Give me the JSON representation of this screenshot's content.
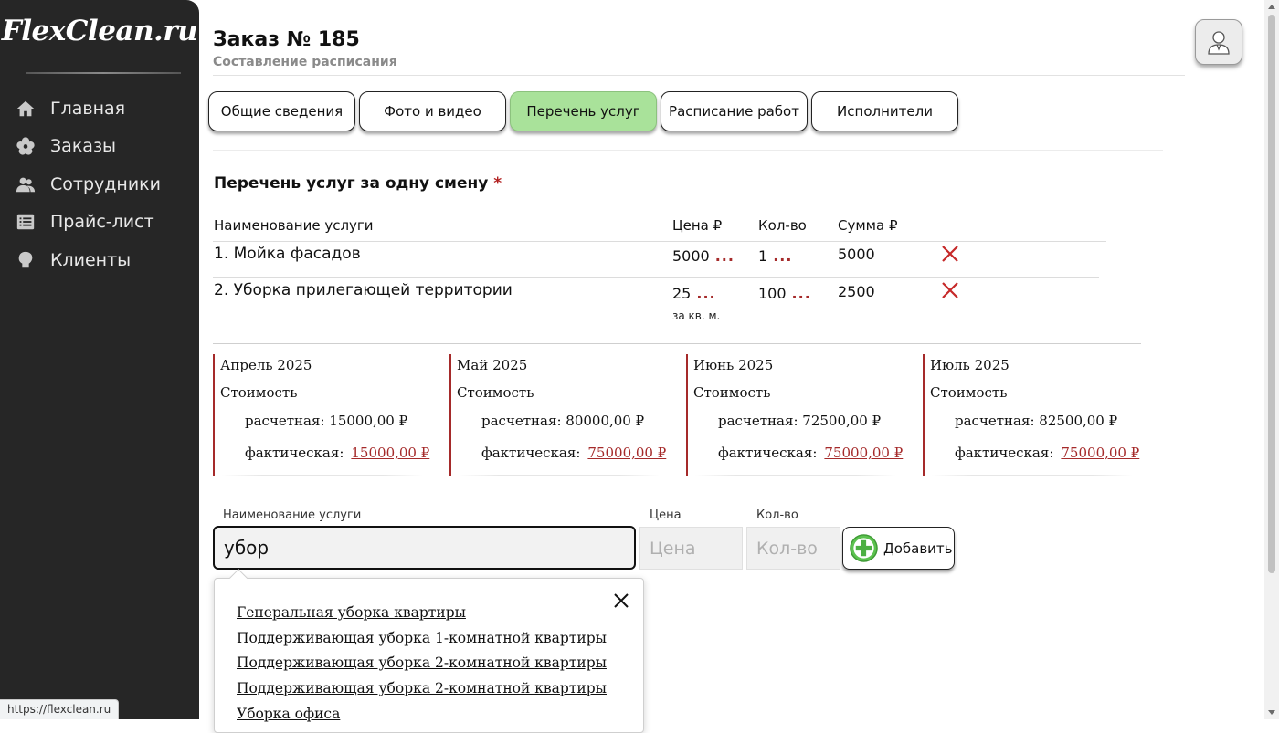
{
  "app": {
    "logo": "FlexClean.ru",
    "status_url": "https://flexclean.ru"
  },
  "sidebar": {
    "items": [
      {
        "label": "Главная",
        "icon": "home-icon"
      },
      {
        "label": "Заказы",
        "icon": "flower-icon"
      },
      {
        "label": "Сотрудники",
        "icon": "users-icon"
      },
      {
        "label": "Прайс-лист",
        "icon": "list-icon"
      },
      {
        "label": "Клиенты",
        "icon": "client-icon"
      }
    ]
  },
  "header": {
    "title": "Заказ № 185",
    "subtitle": "Составление расписания",
    "avatar_icon": "user-avatar-icon"
  },
  "tabs": [
    {
      "label": "Общие сведения",
      "active": false
    },
    {
      "label": "Фото и видео",
      "active": false
    },
    {
      "label": "Перечень услуг",
      "active": true
    },
    {
      "label": "Расписание работ",
      "active": false
    },
    {
      "label": "Исполнители",
      "active": false
    }
  ],
  "services": {
    "title": "Перечень услуг за одну смену",
    "required_mark": "*",
    "columns": {
      "name": "Наименование услуги",
      "price": "Цена ₽",
      "qty": "Кол-во",
      "sum": "Сумма ₽"
    },
    "more": "...",
    "rows": [
      {
        "name": "1. Мойка фасадов",
        "price": "5000",
        "qty": "1",
        "sum": "5000",
        "note": ""
      },
      {
        "name": "2. Уборка прилегающей территории",
        "price": "25",
        "qty": "100",
        "sum": "2500",
        "note": "за кв. м."
      }
    ]
  },
  "months": [
    {
      "name": "Апрель 2025",
      "cost_label": "Стоимость",
      "calc_label": "расчетная:",
      "calc": "15000,00 ₽",
      "fact_label": "фактическая:",
      "fact": "15000,00 ₽"
    },
    {
      "name": "Май 2025",
      "cost_label": "Стоимость",
      "calc_label": "расчетная:",
      "calc": "80000,00 ₽",
      "fact_label": "фактическая:",
      "fact": "75000,00 ₽"
    },
    {
      "name": "Июнь 2025",
      "cost_label": "Стоимость",
      "calc_label": "расчетная:",
      "calc": "72500,00 ₽",
      "fact_label": "фактическая:",
      "fact": "75000,00 ₽"
    },
    {
      "name": "Июль 2025",
      "cost_label": "Стоимость",
      "calc_label": "расчетная:",
      "calc": "82500,00 ₽",
      "fact_label": "фактическая:",
      "fact": "75000,00 ₽"
    }
  ],
  "add_form": {
    "name_label": "Наименование услуги",
    "name_value": "убор",
    "price_label": "Цена",
    "price_placeholder": "Цена",
    "qty_label": "Кол-во",
    "qty_placeholder": "Кол-во",
    "add_button": "Добавить",
    "suggestions": [
      "Генеральная уборка квартиры",
      "Поддерживающая уборка 1-комнатной квартиры",
      "Поддерживающая уборка 2-комнатной квартиры",
      "Поддерживающая уборка 2-комнатной квартиры",
      "Уборка офиса"
    ]
  },
  "colors": {
    "sidebar_bg": "#262626",
    "active_tab": "#a9e29a",
    "accent_red": "#a52a2a",
    "delete_red": "#c62828"
  }
}
